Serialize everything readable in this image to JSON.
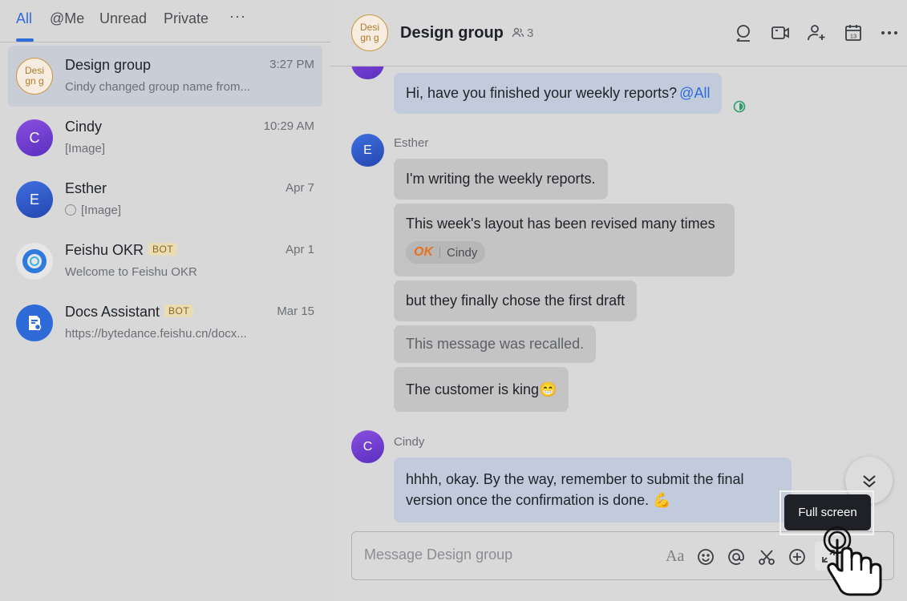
{
  "tabs": [
    {
      "label": "All",
      "active": true
    },
    {
      "label": "@Me"
    },
    {
      "label": "Unread"
    },
    {
      "label": "Private"
    }
  ],
  "tabs_more": "···",
  "chats": [
    {
      "name": "Design group",
      "avatar_text": "Desi gn g",
      "time": "3:27 PM",
      "preview": "Cindy changed group name from...",
      "selected": true
    },
    {
      "name": "Cindy",
      "avatar_text": "C",
      "time": "10:29 AM",
      "preview": "[Image]"
    },
    {
      "name": "Esther",
      "avatar_text": "E",
      "time": "Apr 7",
      "preview": "[Image]"
    },
    {
      "name": "Feishu OKR",
      "badge": "BOT",
      "time": "Apr 1",
      "preview": "Welcome to Feishu OKR"
    },
    {
      "name": "Docs Assistant",
      "badge": "BOT",
      "time": "Mar 15",
      "preview": "https://bytedance.feishu.cn/docx..."
    }
  ],
  "header": {
    "avatar_text": "Desi gn g",
    "title": "Design group",
    "member_count": "3",
    "icons": [
      "search-icon",
      "video-call-icon",
      "add-member-icon",
      "calendar-icon",
      "more-icon"
    ],
    "calendar_day": "13"
  },
  "messages": {
    "mine_1": {
      "text": "Hi, have you finished your weekly reports?",
      "mention": "@All"
    },
    "esther_sender": "Esther",
    "esther_avatar": "E",
    "esther_msgs": [
      "I'm writing the weekly reports.",
      "This week's layout has been revised many times",
      "but they finally chose the first draft",
      "This message was recalled.",
      "The customer is king😁"
    ],
    "reaction": {
      "emoji": "OK",
      "user": "Cindy"
    },
    "cindy_sender": "Cindy",
    "cindy_avatar": "C",
    "cindy_msg_line1": "hhhh, okay. By the way, remember to submit the final",
    "cindy_msg_line2": "version once the confirmation is done. 💪"
  },
  "composer": {
    "placeholder": "Message Design group",
    "format_label": "Aa",
    "icons": [
      "format-icon",
      "emoji-icon",
      "mention-icon",
      "screenshot-icon",
      "add-icon",
      "fullscreen-icon"
    ]
  },
  "tooltip": "Full screen",
  "colors": {
    "accent": "#2f6bd8",
    "bot_badge": "#eadcb5",
    "tooltip_bg": "#1f2126"
  }
}
